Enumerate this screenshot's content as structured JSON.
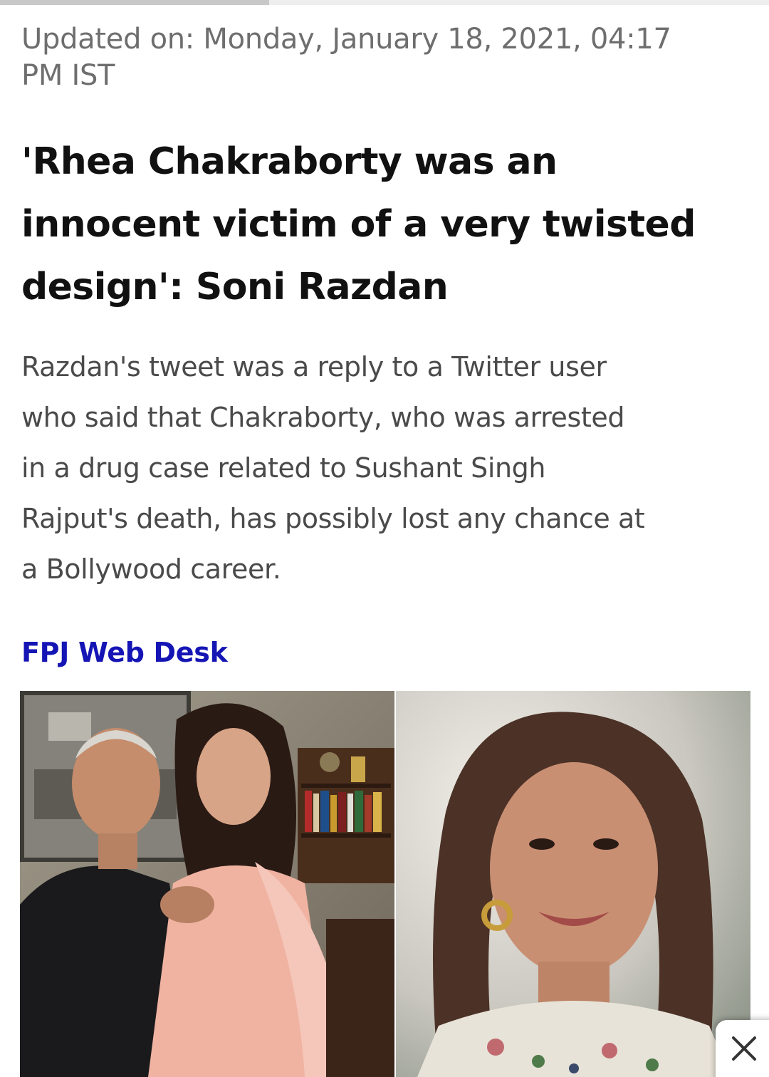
{
  "reading_progress": {
    "fraction": 0.35
  },
  "article": {
    "updated_line1": "Updated on: Monday, January 18, 2021, 04:17",
    "updated_line2": "PM IST",
    "headline_line1": "'Rhea Chakraborty was an",
    "headline_line2": "innocent victim of a very twisted",
    "headline_line3": "design': Soni Razdan",
    "summary_line1": "Razdan's tweet was a reply to a Twitter user",
    "summary_line2": "who said that Chakraborty, who was arrested",
    "summary_line3": "in a drug case related to Sushant Singh",
    "summary_line4": "Rajput's death, has possibly lost any chance at",
    "summary_line5": "a Bollywood career.",
    "byline": "FPJ Web Desk"
  },
  "colors": {
    "byline": "#1515b5",
    "headline": "#111111",
    "summary": "#4a4a4a",
    "updated": "#6e6e6e"
  },
  "icons": {
    "close": "close-icon"
  }
}
